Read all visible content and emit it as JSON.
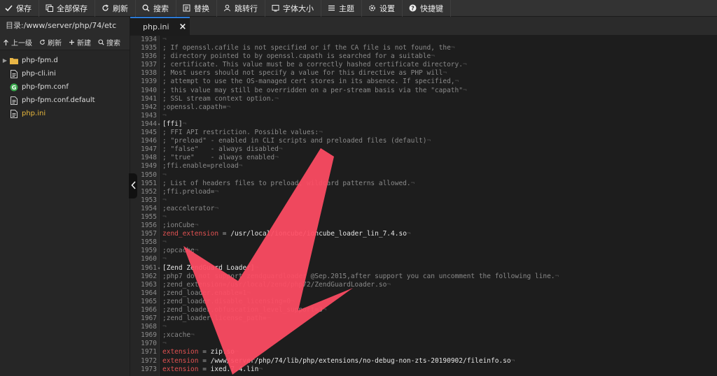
{
  "colors": {
    "accent": "#2c7ad6",
    "arrow": "#ff4b63",
    "key": "#e25252",
    "active_file": "#e7b73c"
  },
  "toolbar": {
    "save": "保存",
    "save_all": "全部保存",
    "refresh": "刷新",
    "search": "搜索",
    "replace": "替换",
    "goto_line": "跳转行",
    "font_size": "字体大小",
    "theme": "主题",
    "settings": "设置",
    "shortcuts": "快捷键"
  },
  "sidebar": {
    "dir_label": "目录:",
    "dir_path": "/www/server/php/74/etc",
    "actions": {
      "up": "上一级",
      "refresh": "刷新",
      "new": "新建",
      "search": "搜索"
    },
    "files": [
      {
        "name": "php-fpm.d",
        "icon": "folder-icon"
      },
      {
        "name": "php-cli.ini",
        "icon": "file-icon"
      },
      {
        "name": "php-fpm.conf",
        "icon": "config-file-icon"
      },
      {
        "name": "php-fpm.conf.default",
        "icon": "file-icon"
      },
      {
        "name": "php.ini",
        "icon": "file-icon"
      }
    ]
  },
  "tab": {
    "label": "php.ini",
    "close": "×"
  },
  "editor": {
    "lines": [
      {
        "n": "1934",
        "t": ""
      },
      {
        "n": "1935",
        "t": "; If openssl.cafile is not specified or if the CA file is not found, the"
      },
      {
        "n": "1936",
        "t": "; directory pointed to by openssl.capath is searched for a suitable"
      },
      {
        "n": "1937",
        "t": "; certificate. This value must be a correctly hashed certificate directory."
      },
      {
        "n": "1938",
        "t": "; Most users should not specify a value for this directive as PHP will"
      },
      {
        "n": "1939",
        "t": "; attempt to use the OS-managed cert stores in its absence. If specified,"
      },
      {
        "n": "1940",
        "t": "; this value may still be overridden on a per-stream basis via the \"capath\""
      },
      {
        "n": "1941",
        "t": "; SSL stream context option."
      },
      {
        "n": "1942",
        "t": ";openssl.capath="
      },
      {
        "n": "1943",
        "t": ""
      },
      {
        "n": "1944",
        "t": "[ffi]"
      },
      {
        "n": "1945",
        "t": "; FFI API restriction. Possible values:"
      },
      {
        "n": "1946",
        "t": "; \"preload\" - enabled in CLI scripts and preloaded files (default)"
      },
      {
        "n": "1947",
        "t": "; \"false\"   - always disabled"
      },
      {
        "n": "1948",
        "t": "; \"true\"    - always enabled"
      },
      {
        "n": "1949",
        "t": ";ffi.enable=preload"
      },
      {
        "n": "1950",
        "t": ""
      },
      {
        "n": "1951",
        "t": "; List of headers files to preload, wildcard patterns allowed."
      },
      {
        "n": "1952",
        "t": ";ffi.preload="
      },
      {
        "n": "1953",
        "t": ""
      },
      {
        "n": "1954",
        "t": ";eaccelerator"
      },
      {
        "n": "1955",
        "t": ""
      },
      {
        "n": "1956",
        "t": ";ionCube"
      },
      {
        "n": "1957",
        "k": "zend_extension",
        "v": "/usr/local/ioncube/ioncube_loader_lin_7.4.so"
      },
      {
        "n": "1958",
        "t": ""
      },
      {
        "n": "1959",
        "t": ";opcache"
      },
      {
        "n": "1960",
        "t": ""
      },
      {
        "n": "1961",
        "t": "[Zend ZendGuard Loader]"
      },
      {
        "n": "1962",
        "t": ";php7 do not support zendguardloader @Sep.2015,after support you can uncomment the following line."
      },
      {
        "n": "1963",
        "t": ";zend_extension=/usr/local/zend/php72/ZendGuardLoader.so"
      },
      {
        "n": "1964",
        "t": ";zend_loader.enable=1"
      },
      {
        "n": "1965",
        "t": ";zend_loader.disable_licensing=0"
      },
      {
        "n": "1966",
        "t": ";zend_loader.obfuscation_level_support=3"
      },
      {
        "n": "1967",
        "t": ";zend_loader.license_path="
      },
      {
        "n": "1968",
        "t": ""
      },
      {
        "n": "1969",
        "t": ";xcache"
      },
      {
        "n": "1970",
        "t": ""
      },
      {
        "n": "1971",
        "k": "extension",
        "v": "zip.so"
      },
      {
        "n": "1972",
        "k": "extension",
        "v": "/www/server/php/74/lib/php/extensions/no-debug-non-zts-20190902/fileinfo.so"
      },
      {
        "n": "1973",
        "k": "extension",
        "v": "ixed.7.4.lin"
      }
    ]
  }
}
